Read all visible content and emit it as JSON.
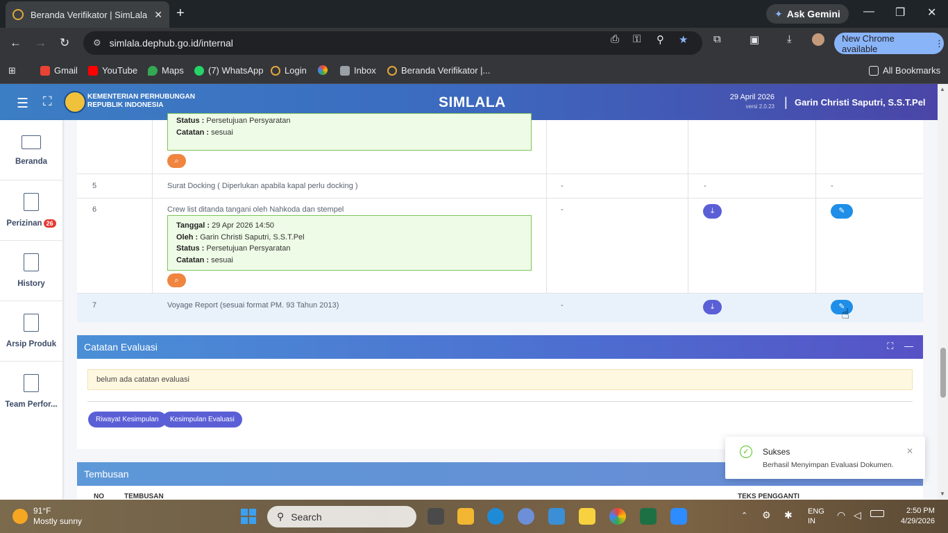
{
  "browser": {
    "tab_title": "Beranda Verifikator | SimLala",
    "new_tab": "+",
    "ask_gemini": "Ask Gemini",
    "url": "simlala.dephub.go.id/internal",
    "update_button": "New Chrome available",
    "bookmarks": [
      "Gmail",
      "YouTube",
      "Maps",
      "(7) WhatsApp",
      "Login",
      "Inbox",
      "Beranda Verifikator |..."
    ],
    "all_bookmarks": "All Bookmarks"
  },
  "header": {
    "ministry_line1": "KEMENTERIAN PERHUBUNGAN",
    "ministry_line2": "REPUBLIK INDONESIA",
    "brand": "SIMLALA",
    "date": "29 April 2026",
    "version": "versi 2.0.23",
    "separator": "|",
    "user": "Garin Christi Saputri, S.S.T.Pel"
  },
  "sidebar": {
    "items": [
      {
        "label": "Beranda"
      },
      {
        "label": "Perizinan",
        "badge": "26"
      },
      {
        "label": "History"
      },
      {
        "label": "Arsip Produk"
      },
      {
        "label": "Team Perfor..."
      }
    ]
  },
  "documents": {
    "prev_status_label": "Status :",
    "prev_status_value": "Persetujuan Persyaratan",
    "prev_note_label": "Catatan :",
    "prev_note_value": "sesuai",
    "rows": [
      {
        "no": "5",
        "name": "Surat Docking ( Diperlukan apabila kapal perlu docking )",
        "col3": "-",
        "col4": "-",
        "col5": "-"
      },
      {
        "no": "6",
        "name": "Crew list ditanda tangani oleh Nahkoda dan stempel",
        "col3": "-",
        "tanggal_label": "Tanggal :",
        "tanggal": "29 Apr 2026 14:50",
        "oleh_label": "Oleh :",
        "oleh": "Garin Christi Saputri, S.S.T.Pel",
        "status_label": "Status :",
        "status": "Persetujuan Persyaratan",
        "catatan_label": "Catatan :",
        "catatan": "sesuai"
      },
      {
        "no": "7",
        "name": "Voyage Report (sesuai format PM. 93 Tahun 2013)",
        "col3": "-"
      }
    ]
  },
  "evaluasi": {
    "title": "Catatan Evaluasi",
    "note": "belum ada catatan evaluasi",
    "btn_riwayat": "Riwayat Kesimpulan",
    "btn_kesimpulan": "Kesimpulan Evaluasi"
  },
  "tembusan": {
    "title": "Tembusan",
    "col_no": "NO",
    "col_tembusan": "TEMBUSAN",
    "col_teks": "TEKS PENGGANTI"
  },
  "toast": {
    "title": "Sukses",
    "message": "Berhasil Menyimpan Evaluasi Dokumen."
  },
  "taskbar": {
    "temp": "91°F",
    "weather": "Mostly sunny",
    "search": "Search",
    "lang1": "ENG",
    "lang2": "IN",
    "time": "2:50 PM",
    "date": "4/29/2026"
  },
  "colors": {
    "header_start": "#3c7ec4",
    "header_end": "#4a46a8",
    "primary_purple": "#5b5fd6",
    "edit_blue": "#1e8ee8",
    "search_orange": "#f0853f",
    "success_green": "#52c41a"
  }
}
